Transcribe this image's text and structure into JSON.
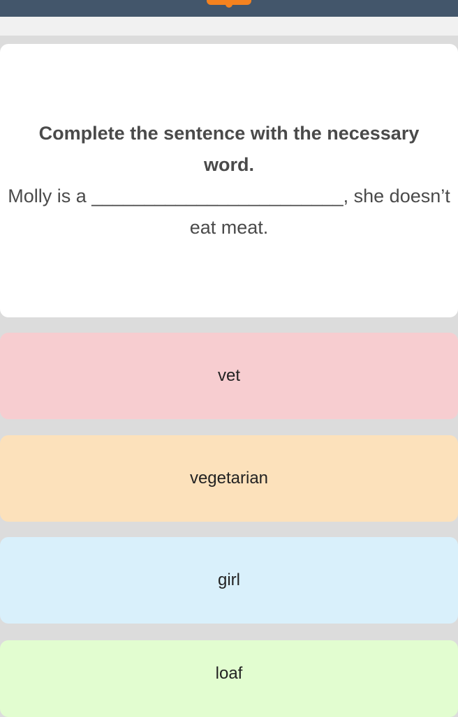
{
  "question": {
    "title": "Complete the sentence with the necessary word.",
    "sentence": "Molly is a ________________________, she doesn’t eat meat."
  },
  "answers": [
    {
      "label": "vet",
      "color": "#f7cdd0"
    },
    {
      "label": "vegetarian",
      "color": "#fce1bb"
    },
    {
      "label": "girl",
      "color": "#d9f0fb"
    },
    {
      "label": "loaf",
      "color": "#e2fdd0"
    }
  ],
  "colors": {
    "topbar": "#43566b",
    "accent": "#f5821f",
    "background": "#dcdcdc",
    "text": "#4a4a4a"
  }
}
